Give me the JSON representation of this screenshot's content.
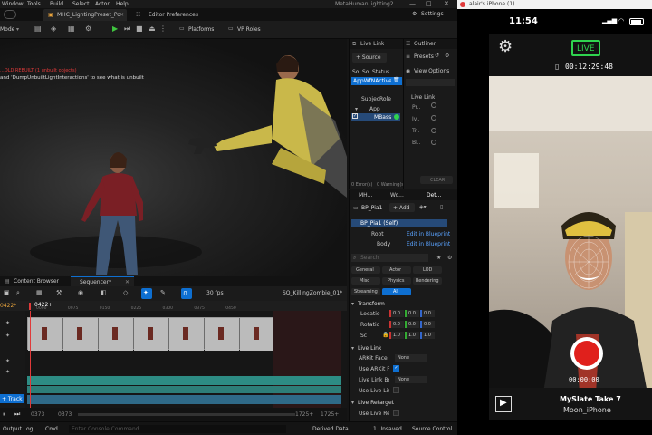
{
  "menu": {
    "items": [
      "Window",
      "Tools",
      "Build",
      "Select",
      "Actor",
      "Help"
    ],
    "app_title": "MetaHumanLighting2"
  },
  "tabs": {
    "level_tab": "MHC_LightingPreset_Po...",
    "editor_prefs": "Editor Preferences",
    "settings": "Settings"
  },
  "toolbar": {
    "mode": "Mode",
    "platforms": "Platforms",
    "vp_roles": "VP Roles"
  },
  "viewport": {
    "error_line1": "...OLD REBUILT (1 unbuilt objects)",
    "error_line2": "and 'DumpUnbuiltLightInteractions' to see what is unbuilt"
  },
  "livelink": {
    "title": "Live Link",
    "source_btn": "+ Source",
    "presets": "Presets",
    "col_so": "So",
    "col_so2": "So",
    "col_status": "Status",
    "source_item": "AppWfNActive",
    "subject_col": "Subjec",
    "role_col": "Role",
    "app_label": "App",
    "mbass_label": "MBass",
    "errors": "0 Error(s)",
    "warnings": "0 Warning(s)",
    "clear": "CLEAR",
    "view_options": "View Options",
    "section": "Live Link",
    "rows": [
      "Pr..",
      "Iv..",
      "Tr..",
      "Bl.."
    ]
  },
  "outliner": {
    "title": "Outliner"
  },
  "details_tabs": [
    "MH...",
    "Wo...",
    "Det..."
  ],
  "details": {
    "actor": "BP_Pia1",
    "add": "+ Add",
    "self_item": "BP_Pia1 (Self)",
    "root": "Root",
    "body": "Body",
    "edit_bp": "Edit in Blueprint",
    "search_placeholder": "Search",
    "filters_row1": [
      "General",
      "Actor",
      "LOD"
    ],
    "filters_row2": [
      "Misc",
      "Physics",
      "Rendering"
    ],
    "filters_row3": [
      "Streaming",
      "All"
    ],
    "transform": "Transform",
    "location": "Locatio",
    "rotation": "Rotatio",
    "scale": "Sc",
    "loc_vals": [
      "0.0",
      "0.0",
      "0.0"
    ],
    "rot_vals": [
      "0.0",
      "0.0",
      "0.0"
    ],
    "scale_vals": [
      "1.0",
      "1.0",
      "1.0"
    ],
    "livelink_section": "Live Link",
    "arkit_face": "ARKit Face...",
    "arkit_val": "None",
    "use_arkit": "Use ARKit F...",
    "livelink_body": "Live Link Bo...",
    "body_val": "None",
    "use_live_link": "Use Live Lin...",
    "live_retarget": "Live Retarget",
    "use_live_ret": "Use Live Ret..."
  },
  "sequencer": {
    "tab_cb": "Content Browser",
    "tab_seq": "Sequencer*",
    "fps": "30 fps",
    "sequence_name": "SQ_KillingZombie_01*",
    "frame": "0422*",
    "frame_red": "0422*",
    "frame_left": "0422+",
    "add_track": "+ Track",
    "tick_labels": [
      "0000",
      "0075",
      "0150",
      "0225",
      "0300",
      "0375",
      "0450",
      "0525"
    ],
    "bottom": [
      "0373",
      "0373",
      "1725+",
      "1725+"
    ]
  },
  "statusbar": {
    "output_log": "Output Log",
    "cmd": "Cmd",
    "console_placeholder": "Enter Console Command",
    "derived_data": "Derived Data",
    "unsaved": "1 Unsaved",
    "source_control": "Source Control"
  },
  "phone": {
    "window_title": "alair's iPhone (1)",
    "time": "11:54",
    "live": "LIVE",
    "timecode": "00:12:29:48",
    "rec_timecode": "00:00:00",
    "slate": "MySlate Take 7",
    "device": "Moon_iPhone"
  },
  "colors": {
    "accent": "#0e6fd1",
    "green": "#2fd44f",
    "record": "#e0201c",
    "teal": "#2d8c84"
  },
  "icons": [
    "gear-icon",
    "play-icon",
    "record-icon",
    "battery-icon",
    "signal-icon",
    "wifi-icon"
  ]
}
